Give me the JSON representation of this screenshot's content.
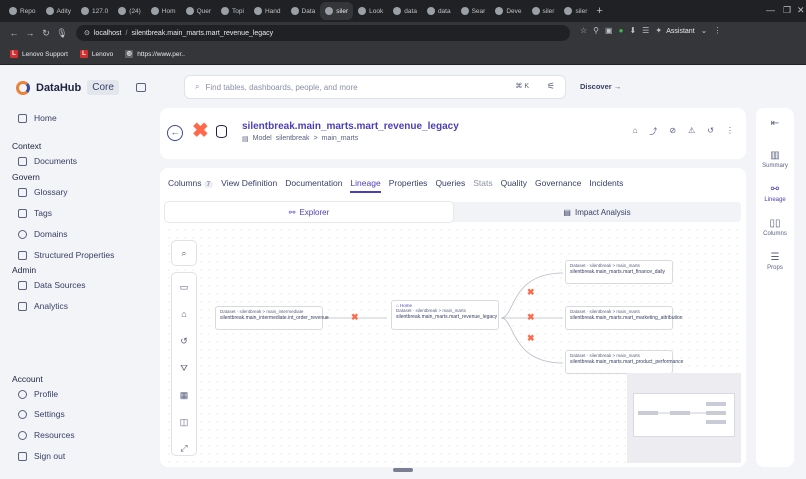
{
  "browser": {
    "tabs": [
      "Repo",
      "Adity",
      "127.0",
      "(24)",
      "Hom",
      "Quer",
      "Topi",
      "Hand",
      "Data",
      "siler",
      "Look",
      "data",
      "data",
      "Sear",
      "Deve",
      "siler",
      "siler"
    ],
    "active_tab_index": 9,
    "url_host": "localhost",
    "url_sep": "/",
    "url_path": "silentbreak.main_marts.mart_revenue_legacy",
    "assistant": "Assistant",
    "bookmarks": [
      "Lenovo Support",
      "Lenovo",
      "https://www.per.."
    ]
  },
  "sidebar": {
    "brand": "DataHub",
    "edition": "Core",
    "home": "Home",
    "context_title": "Context",
    "documents": "Documents",
    "govern_title": "Govern",
    "glossary": "Glossary",
    "tags": "Tags",
    "domains": "Domains",
    "structured_properties": "Structured Properties",
    "admin_title": "Admin",
    "data_sources": "Data Sources",
    "analytics": "Analytics",
    "account_title": "Account",
    "profile": "Profile",
    "settings": "Settings",
    "resources": "Resources",
    "sign_out": "Sign out"
  },
  "search": {
    "placeholder": "Find tables, dashboards, people, and more",
    "shortcut": "⌘ K"
  },
  "discover": "Discover →",
  "entity": {
    "name": "silentbreak.main_marts.mart_revenue_legacy",
    "type": "Model",
    "platform": "silentbreak",
    "schema": "main_marts",
    "sep": ">"
  },
  "tabs": [
    {
      "label": "Columns",
      "count": "7"
    },
    {
      "label": "View Definition"
    },
    {
      "label": "Documentation"
    },
    {
      "label": "Lineage"
    },
    {
      "label": "Properties"
    },
    {
      "label": "Queries"
    },
    {
      "label": "Stats"
    },
    {
      "label": "Quality"
    },
    {
      "label": "Governance"
    },
    {
      "label": "Incidents"
    }
  ],
  "subtabs": {
    "explorer": "Explorer",
    "impact": "Impact Analysis"
  },
  "lineage": {
    "upstream": {
      "kind": "Dataset",
      "path": "silentbreak > main_intermediate",
      "name": "silentbreak.main_intermediate.int_order_revenue"
    },
    "center": {
      "home": "Home",
      "kind": "Dataset",
      "path": "silentbreak > main_marts",
      "name": "silentbreak.main_marts.mart_revenue_legacy"
    },
    "downstream": [
      {
        "kind": "Dataset",
        "path": "silentbreak > main_marts",
        "name": "silentbreak.main_marts.mart_finance_daily"
      },
      {
        "kind": "Dataset",
        "path": "silentbreak > main_marts",
        "name": "silentbreak.main_marts.mart_marketing_attribution"
      },
      {
        "kind": "Dataset",
        "path": "silentbreak > main_marts",
        "name": "silentbreak.main_marts.mart_product_performance"
      }
    ]
  },
  "right_panel": {
    "summary": "Summary",
    "lineage": "Lineage",
    "columns": "Columns",
    "props": "Props"
  }
}
